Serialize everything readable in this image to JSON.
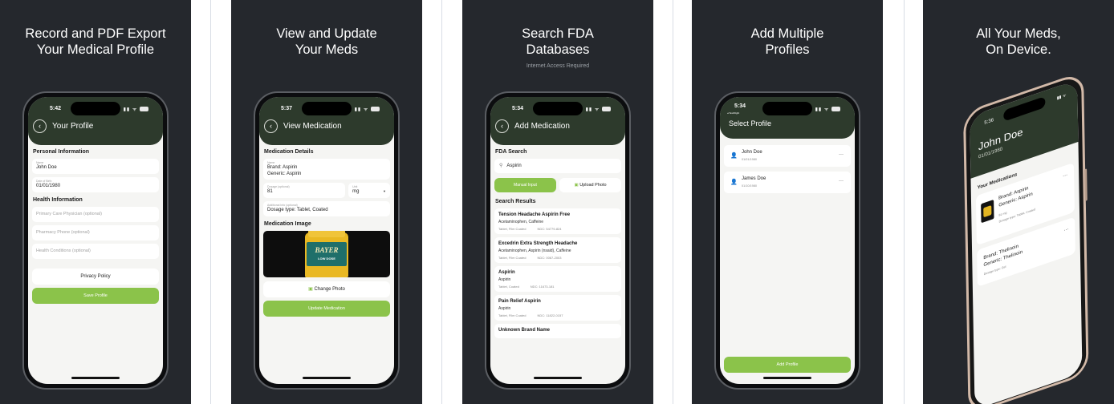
{
  "panels": {
    "p1": {
      "headline": [
        "Record and PDF Export",
        "Your Medical Profile"
      ],
      "time": "5:42",
      "nav_title": "Your Profile",
      "section_personal": "Personal Information",
      "name_label": "Name",
      "name_value": "John Doe",
      "dob_label": "Date of Birth",
      "dob_value": "01/01/1980",
      "section_health": "Health Information",
      "pcp_placeholder": "Primary Care Physician (optional)",
      "pharmacy_placeholder": "Pharmacy Phone (optional)",
      "conditions_placeholder": "Health Conditions (optional)",
      "privacy_label": "Privacy Policy",
      "save_label": "Save Profile"
    },
    "p2": {
      "headline": [
        "View and Update",
        "Your Meds"
      ],
      "time": "5:37",
      "nav_title": "View Medication",
      "section_details": "Medication Details",
      "name_label": "Name",
      "brand": "Brand: Aspirin",
      "generic": "Generic: Aspirin",
      "dosage_label": "Dosage (optional)",
      "dosage_value": "81",
      "unit_label": "Unit",
      "unit_value": "mg",
      "addl_label": "Additional Info (optional)",
      "addl_value": "Dosage type: Tablet, Coated",
      "section_image": "Medication Image",
      "bottle_brand": "BAYER",
      "bottle_sub": "LOW DOSE",
      "change_photo": "Change Photo",
      "update_label": "Update Medication"
    },
    "p3": {
      "headline": [
        "Search FDA",
        "Databases"
      ],
      "subhead": "Internet Access Required",
      "time": "5:34",
      "nav_title": "Add Medication",
      "section_search": "FDA Search",
      "search_value": "Aspirin",
      "manual_input": "Manual Input",
      "upload_photo": "Upload Photo",
      "section_results": "Search Results",
      "results": [
        {
          "title": "Tension Headache Aspirin Free",
          "sub": "Acetaminophen, Caffeine",
          "form": "Tablet, Film Coated",
          "ndc": "NDC: 54779-824"
        },
        {
          "title": "Excedrin Extra Strength Headache",
          "sub": "Acetaminophen, Aspirin (nsaid), Caffeine",
          "form": "Tablet, Film Coated",
          "ndc": "NDC: 0067-2003"
        },
        {
          "title": "Aspirin",
          "sub": "Aspirin",
          "form": "Tablet, Coated",
          "ndc": "NDC: 11673-181"
        },
        {
          "title": "Pain Relief Aspirin",
          "sub": "Aspirin",
          "form": "Tablet, Film Coated",
          "ndc": "NDC: 11822-0157"
        },
        {
          "title": "Unknown Brand Name",
          "sub": "",
          "form": "",
          "ndc": ""
        }
      ]
    },
    "p4": {
      "headline": [
        "Add Multiple",
        "Profiles"
      ],
      "time": "5:34",
      "testflight": "◂ TestFlight",
      "nav_title": "Select Profile",
      "profiles": [
        {
          "name": "John Doe",
          "dob": "01/01/1980"
        },
        {
          "name": "James Doe",
          "dob": "01/10/1980"
        }
      ],
      "add_label": "Add Profile"
    },
    "p5": {
      "headline": [
        "All Your Meds,",
        "On Device."
      ],
      "time": "5:36",
      "name": "John Doe",
      "dob": "01/01/1980",
      "section_meds": "Your Medications",
      "med1_brand": "Brand: Aspirin",
      "med1_generic": "Generic: Aspirin",
      "med1_dose": "81 mg",
      "med1_type": "Dosage type: Tablet, Coated",
      "med2_brand": "Brand: Thelinoin",
      "med2_generic": "Generic: Thelinoin",
      "med2_type": "Dosage type: Gel"
    }
  },
  "icons": {
    "back": "‹",
    "search": "⚲",
    "camera": "▣",
    "person": "👤",
    "dots": "···",
    "signal": "▮▮ ᯤ"
  },
  "colors": {
    "panel_bg": "#25282d",
    "header_green": "#2d3a2c",
    "accent_green": "#8bc34a"
  }
}
